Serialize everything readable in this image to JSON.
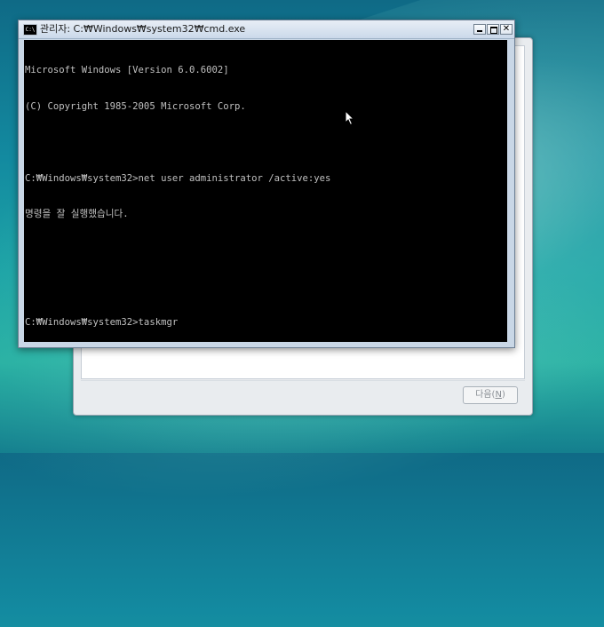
{
  "desktop": {
    "accent_top": "#0f6a86",
    "accent_bottom": "#2bb2a4"
  },
  "setup_dialog": {
    "next_label": "다음(",
    "next_accel": "N",
    "next_close": ")"
  },
  "cmd_window": {
    "title": "관리자: C:₩Windows₩system32₩cmd.exe",
    "icon": "cmd-icon",
    "buttons": {
      "minimize": "minimize-icon",
      "maximize": "maximize-icon",
      "close": "✕"
    },
    "lines": [
      "Microsoft Windows [Version 6.0.6002]",
      "(C) Copyright 1985-2005 Microsoft Corp.",
      "",
      "C:₩Windows₩system32>net user administrator /active:yes",
      "명령을 잘 실행했습니다.",
      "",
      "",
      "C:₩Windows₩system32>taskmgr"
    ]
  }
}
